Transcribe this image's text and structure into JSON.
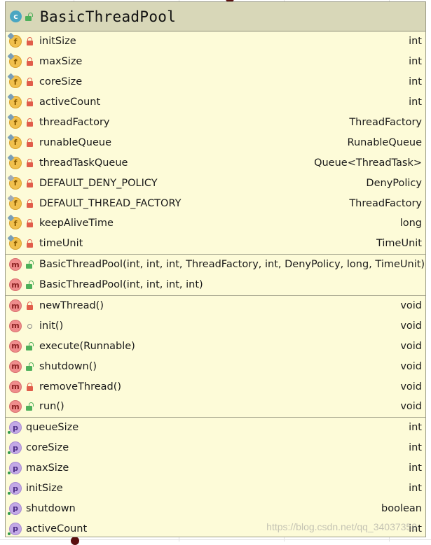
{
  "class": {
    "name": "BasicThreadPool",
    "kind_icon": "c",
    "kind": "class-icon",
    "visibility": "public"
  },
  "fields": [
    {
      "name": "initSize",
      "type": "int",
      "icon": "f",
      "visibility": "private",
      "static": false
    },
    {
      "name": "maxSize",
      "type": "int",
      "icon": "f",
      "visibility": "private",
      "static": false
    },
    {
      "name": "coreSize",
      "type": "int",
      "icon": "f",
      "visibility": "private",
      "static": false
    },
    {
      "name": "activeCount",
      "type": "int",
      "icon": "f",
      "visibility": "private",
      "static": false
    },
    {
      "name": "threadFactory",
      "type": "ThreadFactory",
      "icon": "f",
      "visibility": "private",
      "static": false
    },
    {
      "name": "runableQueue",
      "type": "RunableQueue",
      "icon": "f",
      "visibility": "private",
      "static": false
    },
    {
      "name": "threadTaskQueue",
      "type": "Queue<ThreadTask>",
      "icon": "f",
      "visibility": "private",
      "static": false
    },
    {
      "name": "DEFAULT_DENY_POLICY",
      "type": "DenyPolicy",
      "icon": "f",
      "visibility": "private",
      "static": true
    },
    {
      "name": "DEFAULT_THREAD_FACTORY",
      "type": "ThreadFactory",
      "icon": "f",
      "visibility": "private",
      "static": true
    },
    {
      "name": "keepAliveTime",
      "type": "long",
      "icon": "f",
      "visibility": "private",
      "static": false
    },
    {
      "name": "timeUnit",
      "type": "TimeUnit",
      "icon": "f",
      "visibility": "private",
      "static": false
    }
  ],
  "constructors": [
    {
      "name": "BasicThreadPool(int, int, int, ThreadFactory, int, DenyPolicy, long, TimeUnit)",
      "icon": "m",
      "visibility": "public"
    },
    {
      "name": "BasicThreadPool(int, int, int, int)",
      "icon": "m",
      "visibility": "public"
    }
  ],
  "methods": [
    {
      "name": "newThread()",
      "type": "void",
      "icon": "m",
      "visibility": "private"
    },
    {
      "name": "init()",
      "type": "void",
      "icon": "m",
      "visibility": "package"
    },
    {
      "name": "execute(Runnable)",
      "type": "void",
      "icon": "m",
      "visibility": "public"
    },
    {
      "name": "shutdown()",
      "type": "void",
      "icon": "m",
      "visibility": "public"
    },
    {
      "name": "removeThread()",
      "type": "void",
      "icon": "m",
      "visibility": "private"
    },
    {
      "name": "run()",
      "type": "void",
      "icon": "m",
      "visibility": "public"
    }
  ],
  "properties": [
    {
      "name": "queueSize",
      "type": "int",
      "icon": "p"
    },
    {
      "name": "coreSize",
      "type": "int",
      "icon": "p"
    },
    {
      "name": "maxSize",
      "type": "int",
      "icon": "p"
    },
    {
      "name": "initSize",
      "type": "int",
      "icon": "p"
    },
    {
      "name": "shutdown",
      "type": "boolean",
      "icon": "p"
    },
    {
      "name": "activeCount",
      "type": "int",
      "icon": "p"
    }
  ],
  "watermark": "https://blog.csdn.net/qq_34037358",
  "colors": {
    "header_bg": "#d8d7b8",
    "body_bg": "#fdfbd8",
    "field_icon": "#f1c04d",
    "method_icon": "#ef8c8c",
    "property_icon": "#c3a9e6",
    "class_icon": "#4aa6c2",
    "private_lock": "#e15d4a",
    "public_lock": "#4eb05a"
  }
}
